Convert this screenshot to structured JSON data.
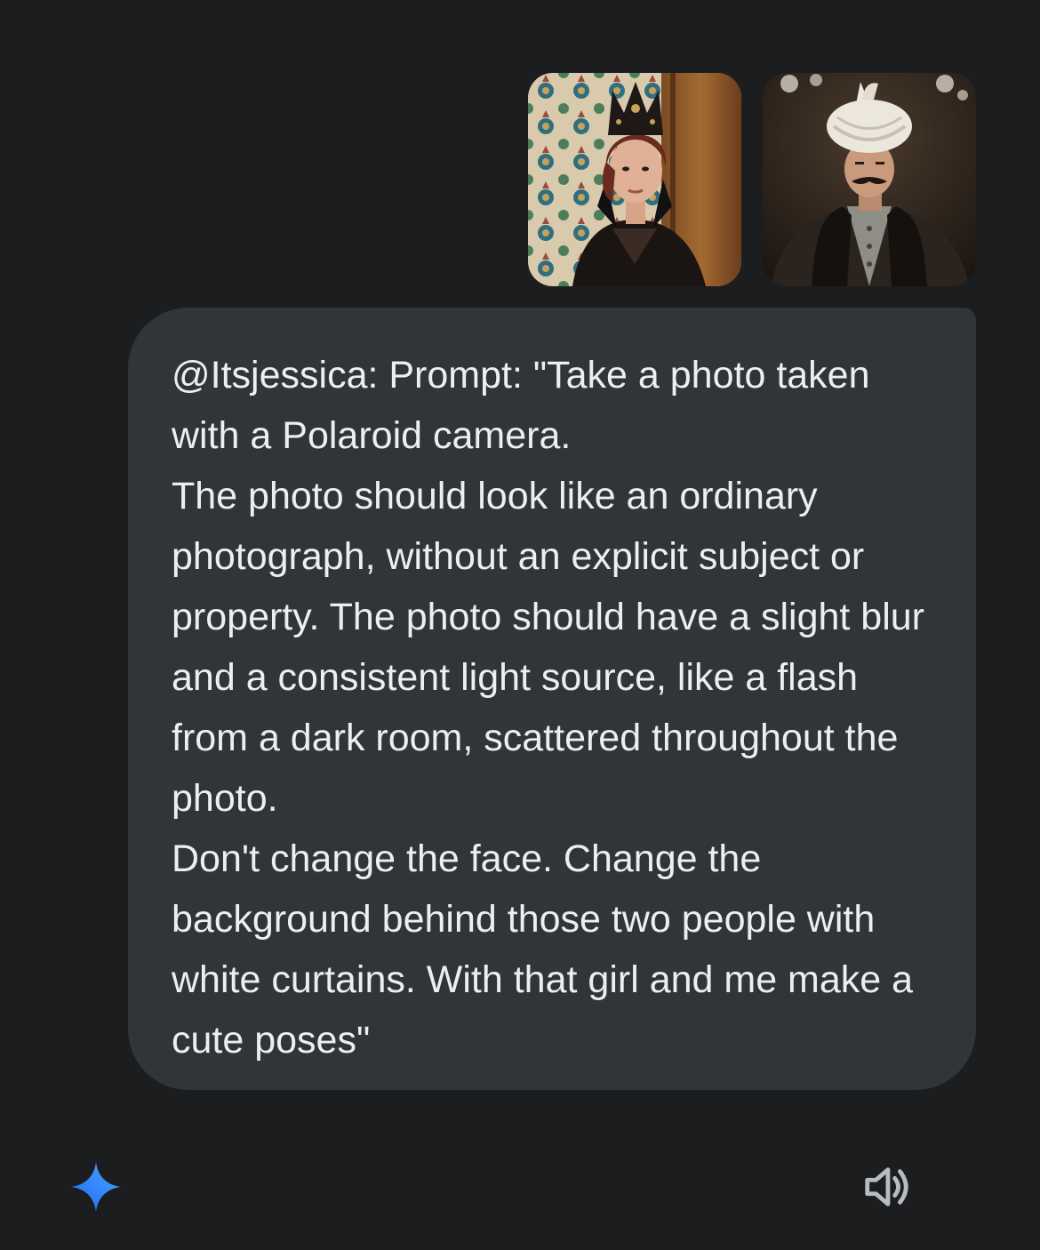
{
  "attachments": [
    {
      "name": "woman-portrait",
      "alt": "Woman in dark ornate gown and crown before tiled wall"
    },
    {
      "name": "man-portrait",
      "alt": "Man in white turban and dark caftan"
    }
  ],
  "message": {
    "text": "@Itsjessica: Prompt: \"Take a photo taken with a Polaroid camera.\nThe photo should look like an ordinary photograph, without an explicit subject or property. The photo should have a slight blur and a consistent light source, like a flash from a dark room, scattered throughout the photo.\nDon't change the face. Change the background behind those two people with white curtains. With that girl and me make a cute poses\""
  },
  "colors": {
    "background": "#1b1d1f",
    "bubble": "#313537",
    "text": "#eceff1",
    "gemini_gradient_start": "#1f6cf2",
    "gemini_gradient_end": "#49a4ff",
    "icon_gray": "#b9bcbf"
  },
  "icons": {
    "assistant": "gemini-sparkle-icon",
    "read_aloud": "speaker-icon"
  }
}
